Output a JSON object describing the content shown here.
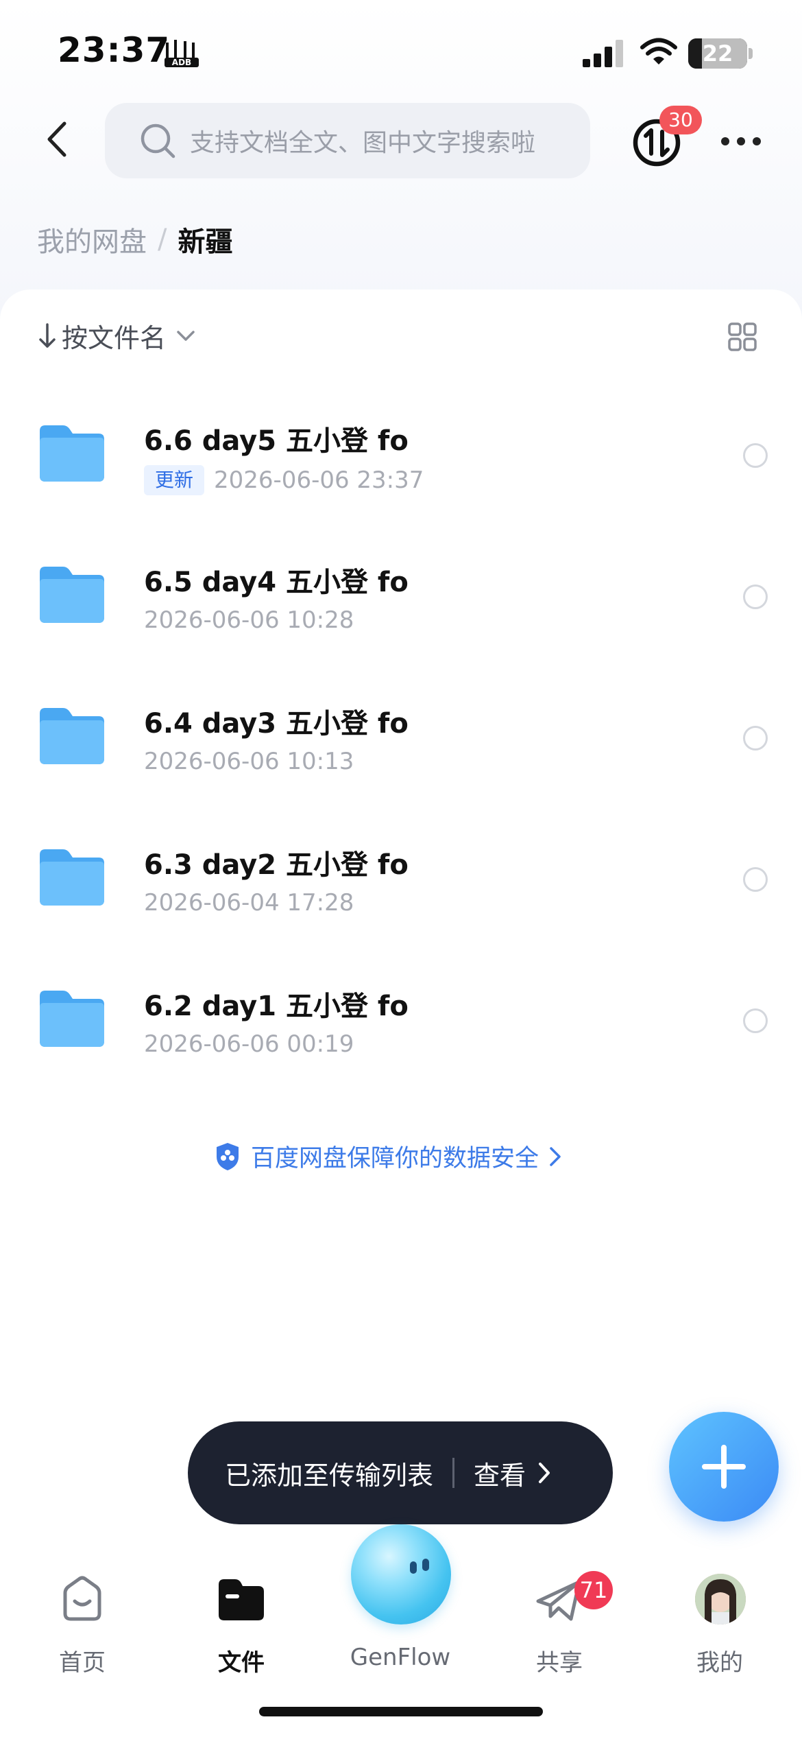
{
  "status_bar": {
    "time": "23:37",
    "battery_level": "22"
  },
  "header": {
    "search_placeholder": "支持文档全文、图中文字搜索啦",
    "transfer_badge_count": "30"
  },
  "breadcrumb": {
    "root": "我的网盘",
    "separator": "/",
    "current": "新疆"
  },
  "sort": {
    "label": "按文件名"
  },
  "files": [
    {
      "name": "6.6 day5 五小登 fo",
      "badge": "更新",
      "date": "2026-06-06 23:37"
    },
    {
      "name": "6.5 day4 五小登 fo",
      "date": "2026-06-06 10:28"
    },
    {
      "name": "6.4 day3 五小登 fo",
      "date": "2026-06-06 10:13"
    },
    {
      "name": "6.3 day2 五小登 fo",
      "date": "2026-06-04 17:28"
    },
    {
      "name": "6.2 day1 五小登 fo",
      "date": "2026-06-06 00:19"
    }
  ],
  "security_notice": "百度网盘保障你的数据安全",
  "toast": {
    "message": "已添加至传输列表",
    "action": "查看"
  },
  "bottom_nav": {
    "home": "首页",
    "files": "文件",
    "genflow": "GenFlow",
    "share": "共享",
    "share_badge": "71",
    "me": "我的"
  },
  "colors": {
    "accent": "#3b8af5",
    "badge_red": "#f2555a",
    "toast_bg": "#1d2230"
  }
}
